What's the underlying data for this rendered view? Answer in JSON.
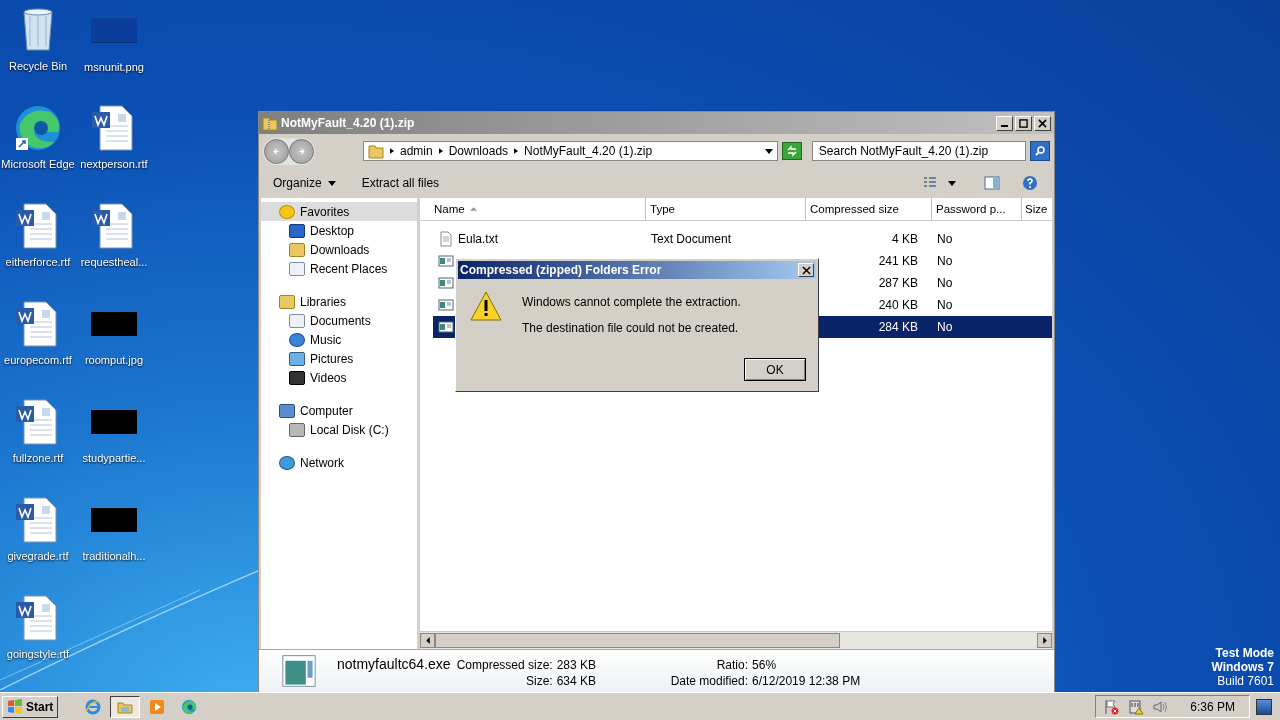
{
  "desktop": {
    "icons": [
      {
        "label": "Recycle Bin",
        "kind": "recycle"
      },
      {
        "label": "Microsoft Edge",
        "kind": "edge"
      },
      {
        "label": "eitherforce.rtf",
        "kind": "word"
      },
      {
        "label": "europecom.rtf",
        "kind": "word"
      },
      {
        "label": "fullzone.rtf",
        "kind": "word"
      },
      {
        "label": "givegrade.rtf",
        "kind": "word"
      },
      {
        "label": "goingstyle.rtf",
        "kind": "word"
      },
      {
        "label": "msnunit.png",
        "kind": "thumb-blue"
      },
      {
        "label": "nextperson.rtf",
        "kind": "word"
      },
      {
        "label": "requestheal...",
        "kind": "word"
      },
      {
        "label": "roomput.jpg",
        "kind": "thumb-black"
      },
      {
        "label": "studypartie...",
        "kind": "thumb-black"
      },
      {
        "label": "traditionalh...",
        "kind": "thumb-black"
      }
    ],
    "watermark": [
      "Test Mode",
      "Windows 7",
      "Build 7601"
    ]
  },
  "explorer": {
    "title": "NotMyFault_4.20 (1).zip",
    "breadcrumbs": [
      "admin",
      "Downloads",
      "NotMyFault_4.20 (1).zip"
    ],
    "search": {
      "placeholder": "Search NotMyFault_4.20 (1).zip"
    },
    "toolbar": [
      "Organize",
      "Extract all files"
    ],
    "nav": [
      {
        "label": "Favorites",
        "kind": "star",
        "selected": true,
        "children": [
          {
            "label": "Desktop",
            "kind": "desktop",
            "selected": false
          },
          {
            "label": "Downloads",
            "kind": "downloads",
            "selected": false
          },
          {
            "label": "Recent Places",
            "kind": "recent",
            "selected": false
          }
        ]
      },
      {
        "label": "Libraries",
        "kind": "library",
        "selected": false,
        "children": [
          {
            "label": "Documents",
            "kind": "documents",
            "selected": false
          },
          {
            "label": "Music",
            "kind": "music",
            "selected": false
          },
          {
            "label": "Pictures",
            "kind": "pictures",
            "selected": false
          },
          {
            "label": "Videos",
            "kind": "videos",
            "selected": false
          }
        ]
      },
      {
        "label": "Computer",
        "kind": "computer",
        "selected": false,
        "children": [
          {
            "label": "Local Disk (C:)",
            "kind": "disk",
            "selected": false
          }
        ]
      },
      {
        "label": "Network",
        "kind": "network",
        "selected": false
      }
    ],
    "columns": [
      "Name",
      "Type",
      "Compressed size",
      "Password p...",
      "Size"
    ],
    "files": [
      {
        "name": "Eula.txt",
        "type": "Text Document",
        "compressed": "4 KB",
        "password": "No",
        "kind": "text",
        "selected": false
      },
      {
        "compressed": "241 KB",
        "password": "No",
        "kind": "exe",
        "selected": false
      },
      {
        "compressed": "287 KB",
        "password": "No",
        "kind": "exe",
        "selected": false
      },
      {
        "compressed": "240 KB",
        "password": "No",
        "kind": "exe",
        "selected": false
      },
      {
        "compressed": "284 KB",
        "password": "No",
        "kind": "exe",
        "selected": true
      }
    ],
    "details": {
      "filename": "notmyfaultc64.exe",
      "fields": [
        {
          "label": "Compressed size:",
          "value": "283 KB"
        },
        {
          "label": "Ratio:",
          "value": "56%"
        },
        {
          "label": "Size:",
          "value": "634 KB"
        },
        {
          "label": "Date modified:",
          "value": "6/12/2019 12:38 PM"
        }
      ]
    }
  },
  "dialog": {
    "title": "Compressed (zipped) Folders Error",
    "messages": [
      "Windows cannot complete the extraction.",
      "The destination file could not be created."
    ],
    "button": "OK"
  },
  "taskbar": {
    "start": "Start",
    "apps": [
      {
        "kind": "ie",
        "selected": false
      },
      {
        "kind": "explorer",
        "selected": true
      },
      {
        "kind": "media",
        "selected": false
      },
      {
        "kind": "edge",
        "selected": false
      }
    ],
    "clock": "6:36 PM"
  }
}
